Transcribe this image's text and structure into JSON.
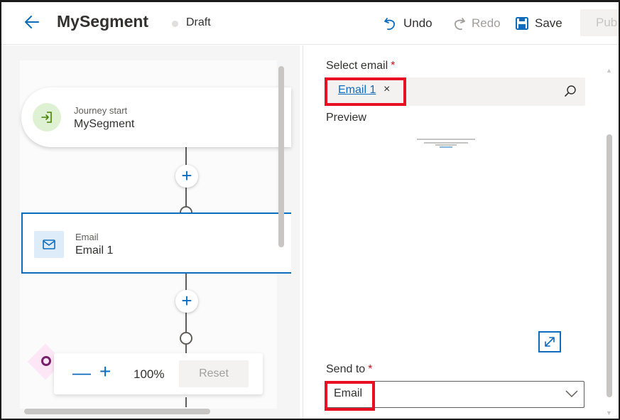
{
  "header": {
    "title": "MySegment",
    "status": "Draft",
    "undo_label": "Undo",
    "redo_label": "Redo",
    "save_label": "Save",
    "publish_label": "Pub"
  },
  "canvas": {
    "start_node": {
      "type_label": "Journey start",
      "name": "MySegment"
    },
    "email_node": {
      "type_label": "Email",
      "name": "Email 1"
    },
    "add_step_symbol": "+",
    "zoom": {
      "minus": "—",
      "plus": "+",
      "level": "100%",
      "reset_label": "Reset"
    }
  },
  "panel": {
    "select_email_label": "Select email",
    "required_mark": "*",
    "selected_email": "Email 1",
    "remove_symbol": "×",
    "preview_label": "Preview",
    "send_to_label": "Send to",
    "send_to_value": "Email"
  },
  "colors": {
    "accent": "#0f6cbd",
    "highlight": "#e81123",
    "required": "#c50f1f",
    "start_icon_bg": "#dff1d3",
    "email_icon_bg": "#deecf9"
  },
  "icons": {
    "back": "arrow-left-icon",
    "undo": "undo-icon",
    "redo": "redo-icon",
    "save": "save-icon",
    "start": "journey-start-icon",
    "email": "mail-icon",
    "search": "search-icon",
    "expand": "expand-icon",
    "chevron": "chevron-down-icon"
  }
}
